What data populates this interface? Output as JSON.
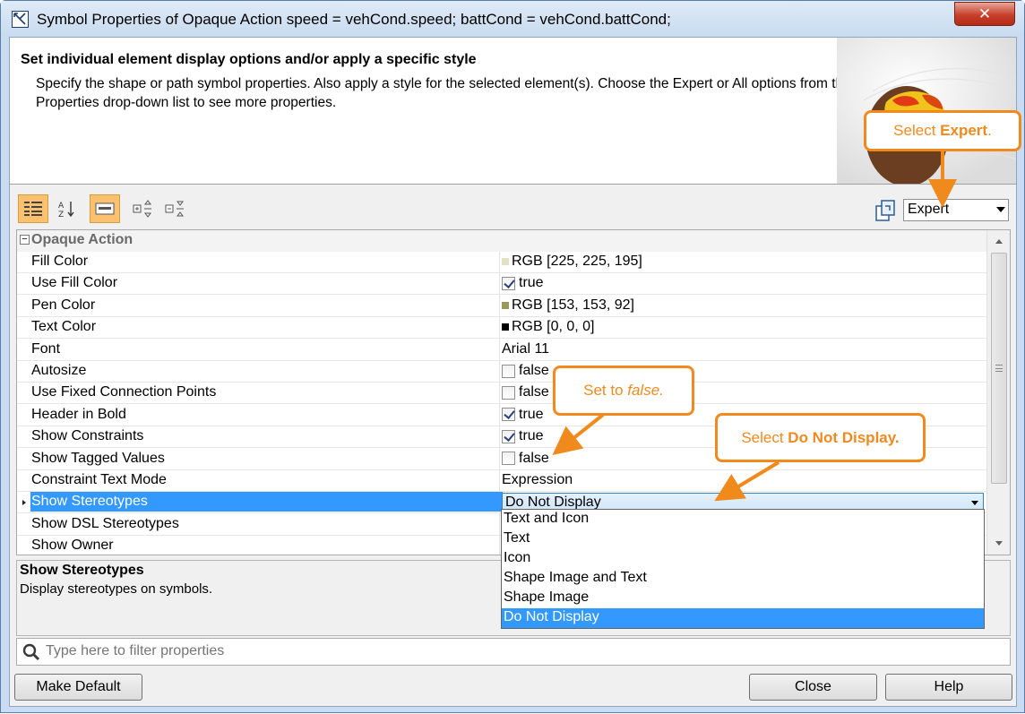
{
  "window": {
    "title": "Symbol Properties of Opaque Action speed = vehCond.speed;  battCond = vehCond.battCond;",
    "close_label": "✕"
  },
  "header": {
    "title": "Set individual element display options and/or apply a specific style",
    "description": "Specify the shape or path symbol properties. Also apply a style for the selected element(s). Choose the Expert or All options from the Properties drop-down list to see more properties."
  },
  "toolbar": {
    "mode_select_value": "Expert"
  },
  "grid": {
    "group_label": "Opaque Action",
    "rows": [
      {
        "name": "Fill Color",
        "value": "RGB [225, 225, 195]",
        "kind": "color",
        "swatch": "#e1e1c3"
      },
      {
        "name": "Use Fill Color",
        "value": "true",
        "kind": "check",
        "checked": true
      },
      {
        "name": "Pen Color",
        "value": "RGB [153, 153, 92]",
        "kind": "color",
        "swatch": "#99995c"
      },
      {
        "name": "Text Color",
        "value": "RGB [0, 0, 0]",
        "kind": "color",
        "swatch": "#000000"
      },
      {
        "name": "Font",
        "value": "Arial 11",
        "kind": "text"
      },
      {
        "name": "Autosize",
        "value": "false",
        "kind": "check",
        "checked": false
      },
      {
        "name": "Use Fixed Connection Points",
        "value": "false",
        "kind": "check",
        "checked": false
      },
      {
        "name": "Header in Bold",
        "value": "true",
        "kind": "check",
        "checked": true
      },
      {
        "name": "Show Constraints",
        "value": "true",
        "kind": "check",
        "checked": true
      },
      {
        "name": "Show Tagged Values",
        "value": "false",
        "kind": "check",
        "checked": false
      },
      {
        "name": "Constraint Text Mode",
        "value": "Expression",
        "kind": "text"
      },
      {
        "name": "Show Stereotypes",
        "value": "Do Not Display",
        "kind": "dropdown",
        "selected": true
      },
      {
        "name": "Show DSL Stereotypes",
        "value": "",
        "kind": "text"
      },
      {
        "name": "Show Owner",
        "value": "",
        "kind": "text"
      }
    ]
  },
  "dropdown_options": [
    "Text and Icon",
    "Text",
    "Icon",
    "Shape Image and Text",
    "Shape Image",
    "Do Not Display"
  ],
  "dropdown_selected_index": 5,
  "description_panel": {
    "title": "Show Stereotypes",
    "text": "Display stereotypes on symbols."
  },
  "filter": {
    "placeholder": "Type here to filter properties"
  },
  "buttons": {
    "make_default": "Make Default",
    "close": "Close",
    "help": "Help"
  },
  "callouts": {
    "expert_prefix": "Select ",
    "expert_bold": "Expert",
    "expert_suffix": ".",
    "false_prefix": "Set to ",
    "false_italic": "false.",
    "donot_prefix": "Select ",
    "donot_bold": "Do Not Display."
  },
  "colors": {
    "accent_orange": "#f08a1d",
    "selection_blue": "#3399ff"
  }
}
